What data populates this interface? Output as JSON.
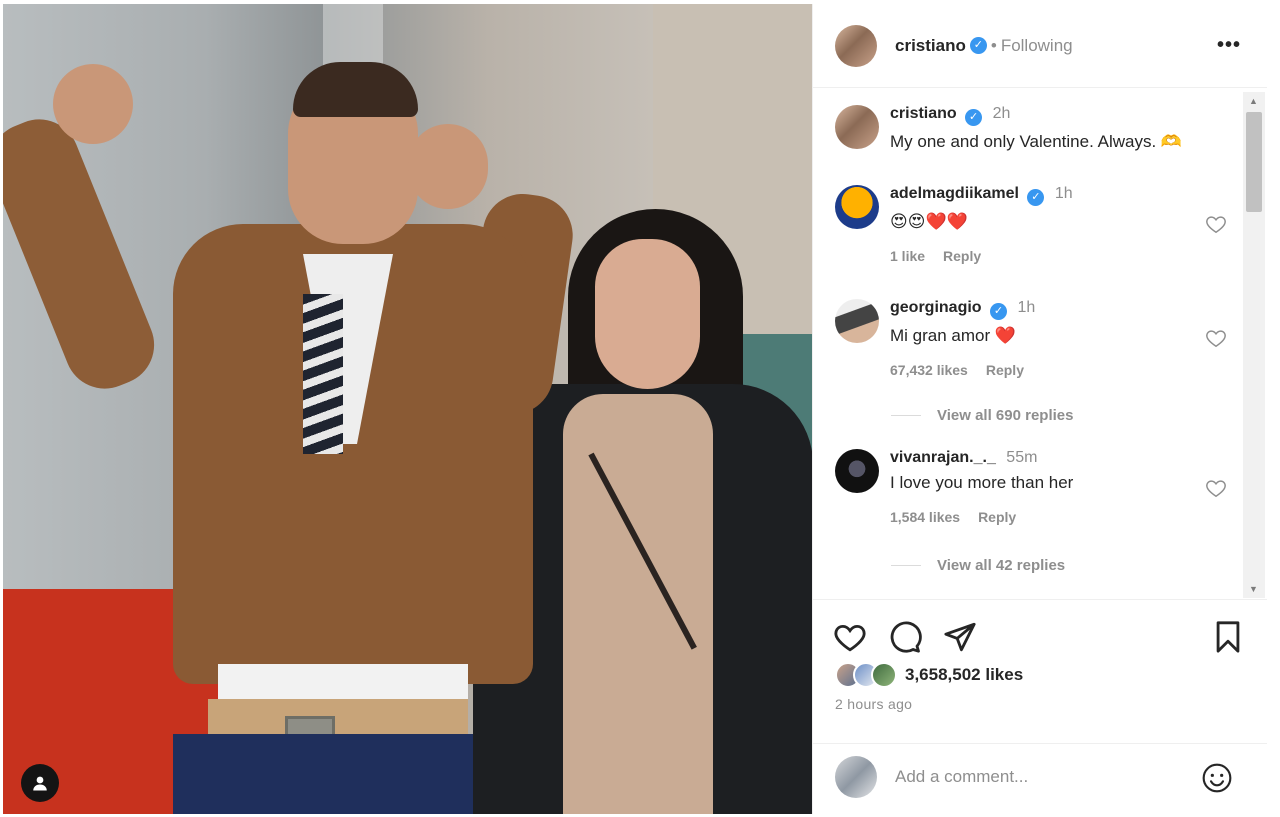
{
  "post": {
    "author": "cristiano",
    "follow_status": "Following",
    "separator": "•",
    "more_label": "•••",
    "caption": "My one and only Valentine. Always. 🫶",
    "caption_time": "2h"
  },
  "comments": [
    {
      "user": "adelmagdiikamel",
      "time": "1h",
      "text": "😍😍❤️❤️",
      "likes": "1 like",
      "reply": "Reply",
      "verified": true
    },
    {
      "user": "georginagio",
      "time": "1h",
      "text": "Mi gran amor ❤️",
      "likes": "67,432 likes",
      "reply": "Reply",
      "verified": true,
      "view_replies": "View all 690 replies"
    },
    {
      "user": "vivanrajan._._",
      "time": "55m",
      "text": "I love you more than her",
      "likes": "1,584 likes",
      "reply": "Reply",
      "verified": false,
      "view_replies": "View all 42 replies"
    }
  ],
  "footer": {
    "likes_count": "3,658,502 likes",
    "posted_ago": "2 hours ago",
    "comment_placeholder": "Add a comment..."
  },
  "icons": [
    "heart-icon",
    "comment-icon",
    "share-icon",
    "bookmark-icon",
    "emoji-icon",
    "user-icon",
    "more-icon",
    "verified-icon"
  ],
  "colors": {
    "verified": "#3897f0",
    "muted": "#8e8e8e",
    "text": "#262626",
    "heart": "#e0245e"
  }
}
